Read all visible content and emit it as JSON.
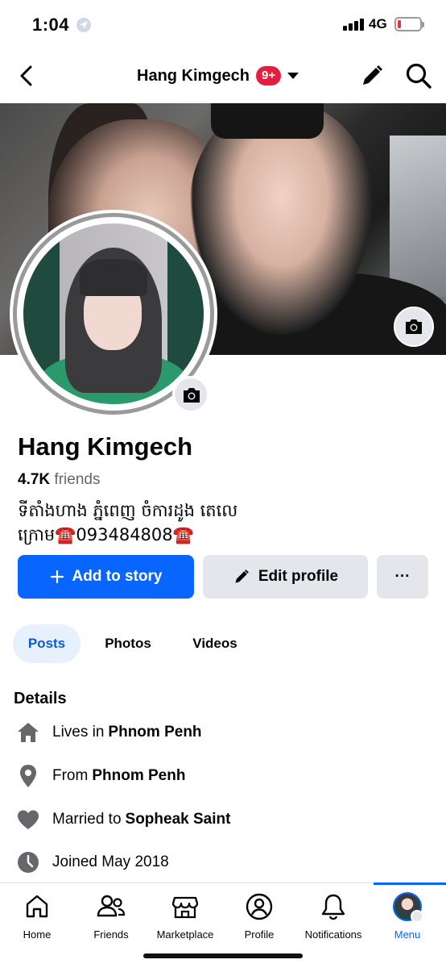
{
  "status_bar": {
    "time": "1:04",
    "network": "4G",
    "battery_level": 0.15,
    "colors": {
      "battery_low": "#e8323c"
    }
  },
  "nav": {
    "title": "Hang Kimgech",
    "badge": "9+"
  },
  "profile": {
    "name": "Hang Kimgech",
    "friends_count": "4.7K",
    "friends_label": "friends",
    "bio": "ទីតាំងហាង ភ្នំពេញ ចំការដូង តេលេក្រោម☎️093484808☎️"
  },
  "actions": {
    "add_story": "Add to story",
    "edit_profile": "Edit profile",
    "more": "···"
  },
  "tabs": [
    {
      "label": "Posts",
      "active": true
    },
    {
      "label": "Photos",
      "active": false
    },
    {
      "label": "Videos",
      "active": false
    }
  ],
  "details": {
    "title": "Details",
    "items": [
      {
        "icon": "home-icon",
        "prefix": "Lives in",
        "value": "Phnom Penh"
      },
      {
        "icon": "location-pin-icon",
        "prefix": "From",
        "value": "Phnom Penh"
      },
      {
        "icon": "heart-icon",
        "prefix": "Married to",
        "value": "Sopheak Saint"
      },
      {
        "icon": "clock-icon",
        "prefix": "Joined May 2018",
        "value": ""
      }
    ]
  },
  "tabbar": {
    "items": [
      {
        "label": "Home",
        "icon": "home-outline-icon"
      },
      {
        "label": "Friends",
        "icon": "friends-icon"
      },
      {
        "label": "Marketplace",
        "icon": "marketplace-icon"
      },
      {
        "label": "Profile",
        "icon": "profile-icon"
      },
      {
        "label": "Notifications",
        "icon": "bell-icon"
      },
      {
        "label": "Menu",
        "icon": "menu-avatar-icon",
        "active": true
      }
    ]
  },
  "colors": {
    "primary": "#0866ff",
    "badge": "#e41e3f",
    "secondary_button": "#e4e6eb",
    "active_tab_bg": "#e7f0fd"
  }
}
